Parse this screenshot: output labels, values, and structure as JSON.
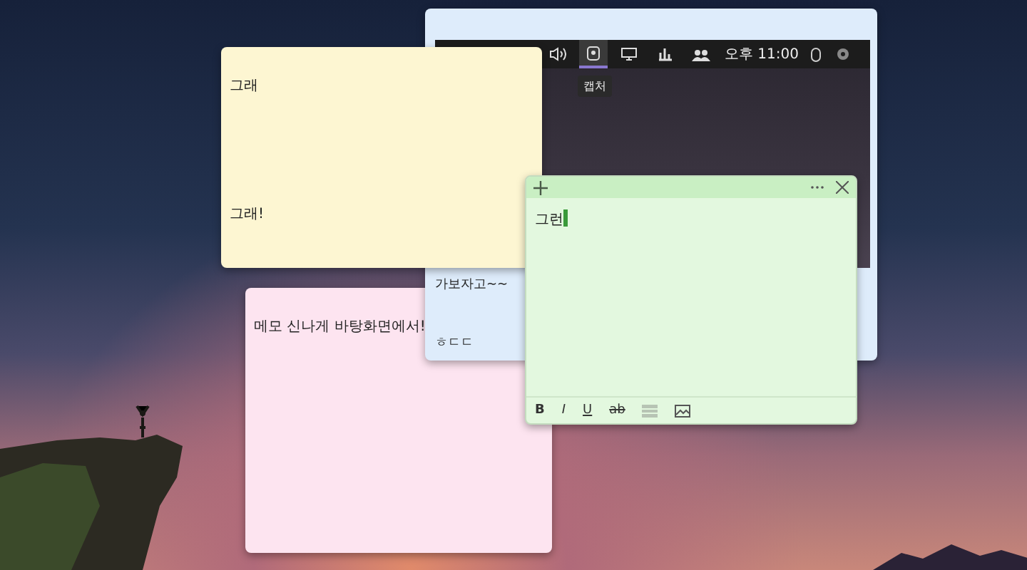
{
  "notes": [
    {
      "kind": "plain",
      "color": "#fde4f0",
      "lines": [
        "메모 신나게 바탕화면에서!"
      ]
    },
    {
      "kind": "capture",
      "color": "#deecfb",
      "capture": {
        "icons": [
          {
            "kind": "volume",
            "selected": false
          },
          {
            "kind": "capture",
            "selected": true
          },
          {
            "kind": "display",
            "selected": false
          },
          {
            "kind": "chart",
            "selected": false
          },
          {
            "kind": "people",
            "selected": false
          }
        ],
        "time": "오후 11:00",
        "tray": [
          {
            "kind": "mouse",
            "selected": false
          },
          {
            "kind": "gear",
            "selected": false
          }
        ],
        "tooltip": "캡처"
      },
      "lines": [
        "가보자고~~",
        "ㅎㄷㄷ"
      ]
    },
    {
      "kind": "plain",
      "color": "#fdf6d2",
      "lines": [
        "그래",
        "그래!"
      ]
    },
    {
      "kind": "editor",
      "color": "#e3f8df",
      "text": "그런",
      "toolbar": [
        {
          "kind": "text",
          "label": "B"
        },
        {
          "kind": "text",
          "label": "I"
        },
        {
          "kind": "text",
          "label": "U"
        },
        {
          "kind": "text",
          "label": "ab"
        },
        {
          "kind": "list"
        },
        {
          "kind": "image"
        }
      ]
    }
  ]
}
